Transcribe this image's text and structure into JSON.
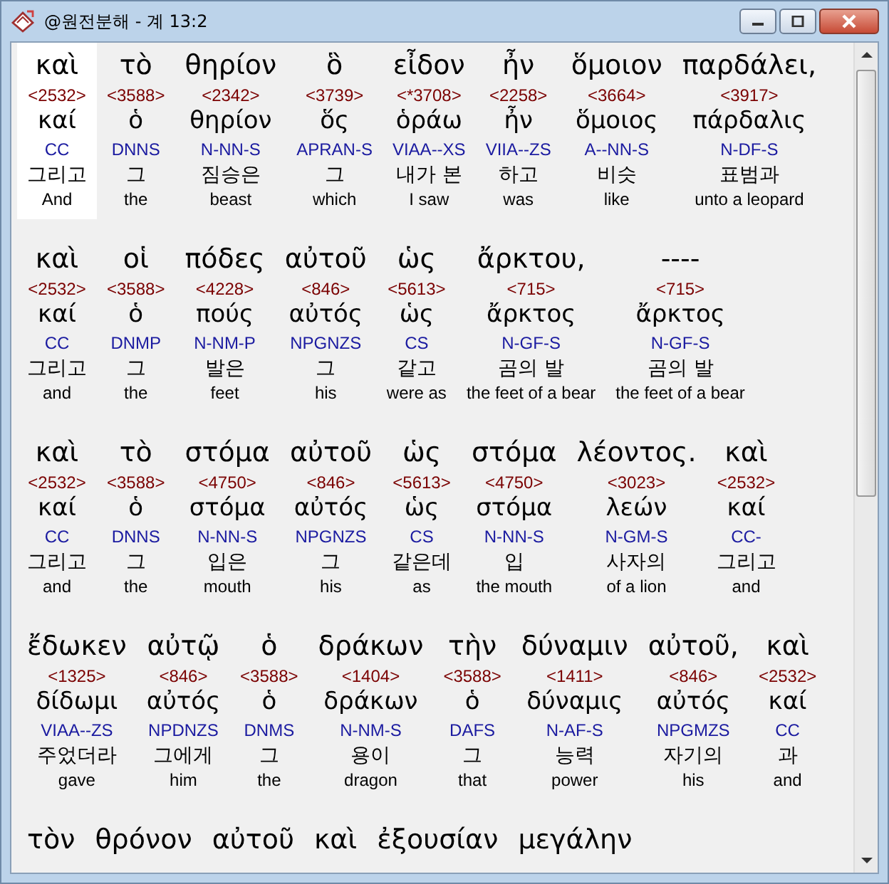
{
  "window": {
    "title": "@원전분해 - 계 13:2"
  },
  "lines": [
    {
      "words": [
        {
          "greek": "καὶ",
          "strong": "<2532>",
          "lemma": "καί",
          "morph": "CC",
          "korean": "그리고",
          "english": "And",
          "selected": true
        },
        {
          "greek": "τὸ",
          "strong": "<3588>",
          "lemma": "ὁ",
          "morph": "DNNS",
          "korean": "그",
          "english": "the",
          "selected": false
        },
        {
          "greek": "θηρίον",
          "strong": "<2342>",
          "lemma": "θηρίον",
          "morph": "N-NN-S",
          "korean": "짐승은",
          "english": "beast",
          "selected": false
        },
        {
          "greek": "ὃ",
          "strong": "<3739>",
          "lemma": "ὅς",
          "morph": "APRAN-S",
          "korean": "그",
          "english": "which",
          "selected": false
        },
        {
          "greek": "εἶδον",
          "strong": "<*3708>",
          "lemma": "ὁράω",
          "morph": "VIAA--XS",
          "korean": "내가 본",
          "english": "I saw",
          "selected": false
        },
        {
          "greek": "ἦν",
          "strong": "<2258>",
          "lemma": "ἦν",
          "morph": "VIIA--ZS",
          "korean": "하고",
          "english": "was",
          "selected": false
        },
        {
          "greek": "ὅμοιον",
          "strong": "<3664>",
          "lemma": "ὅμοιος",
          "morph": "A--NN-S",
          "korean": "비슷",
          "english": "like",
          "selected": false
        },
        {
          "greek": "παρδάλει,",
          "strong": "<3917>",
          "lemma": "πάρδαλις",
          "morph": "N-DF-S",
          "korean": "표범과",
          "english": "unto a leopard",
          "selected": false
        }
      ]
    },
    {
      "words": [
        {
          "greek": "καὶ",
          "strong": "<2532>",
          "lemma": "καί",
          "morph": "CC",
          "korean": "그리고",
          "english": "and",
          "selected": false
        },
        {
          "greek": "οἱ",
          "strong": "<3588>",
          "lemma": "ὁ",
          "morph": "DNMP",
          "korean": "그",
          "english": "the",
          "selected": false
        },
        {
          "greek": "πόδες",
          "strong": "<4228>",
          "lemma": "πούς",
          "morph": "N-NM-P",
          "korean": "발은",
          "english": "feet",
          "selected": false
        },
        {
          "greek": "αὐτοῦ",
          "strong": "<846>",
          "lemma": "αὐτός",
          "morph": "NPGNZS",
          "korean": "그",
          "english": "his",
          "selected": false
        },
        {
          "greek": "ὡς",
          "strong": "<5613>",
          "lemma": "ὡς",
          "morph": "CS",
          "korean": "같고",
          "english": "were as",
          "selected": false
        },
        {
          "greek": "ἄρκτου,",
          "strong": "<715>",
          "lemma": "ἄρκτος",
          "morph": "N-GF-S",
          "korean": "곰의 발",
          "english": "the feet of a bear",
          "selected": false
        },
        {
          "greek": "----",
          "strong": "<715>",
          "lemma": "ἄρκτος",
          "morph": "N-GF-S",
          "korean": "곰의 발",
          "english": "the feet of a bear",
          "selected": false
        }
      ]
    },
    {
      "words": [
        {
          "greek": "καὶ",
          "strong": "<2532>",
          "lemma": "καί",
          "morph": "CC",
          "korean": "그리고",
          "english": "and",
          "selected": false
        },
        {
          "greek": "τὸ",
          "strong": "<3588>",
          "lemma": "ὁ",
          "morph": "DNNS",
          "korean": "그",
          "english": "the",
          "selected": false
        },
        {
          "greek": "στόμα",
          "strong": "<4750>",
          "lemma": "στόμα",
          "morph": "N-NN-S",
          "korean": "입은",
          "english": "mouth",
          "selected": false
        },
        {
          "greek": "αὐτοῦ",
          "strong": "<846>",
          "lemma": "αὐτός",
          "morph": "NPGNZS",
          "korean": "그",
          "english": "his",
          "selected": false
        },
        {
          "greek": "ὡς",
          "strong": "<5613>",
          "lemma": "ὡς",
          "morph": "CS",
          "korean": "같은데",
          "english": "as",
          "selected": false
        },
        {
          "greek": "στόμα",
          "strong": "<4750>",
          "lemma": "στόμα",
          "morph": "N-NN-S",
          "korean": "입",
          "english": "the mouth",
          "selected": false
        },
        {
          "greek": "λέοντος.",
          "strong": "<3023>",
          "lemma": "λεών",
          "morph": "N-GM-S",
          "korean": "사자의",
          "english": "of a lion",
          "selected": false
        },
        {
          "greek": "καὶ",
          "strong": "<2532>",
          "lemma": "καί",
          "morph": "CC-",
          "korean": "그리고",
          "english": "and",
          "selected": false
        }
      ]
    },
    {
      "words": [
        {
          "greek": "ἔδωκεν",
          "strong": "<1325>",
          "lemma": "δίδωμι",
          "morph": "VIAA--ZS",
          "korean": "주었더라",
          "english": "gave",
          "selected": false
        },
        {
          "greek": "αὐτῷ",
          "strong": "<846>",
          "lemma": "αὐτός",
          "morph": "NPDNZS",
          "korean": "그에게",
          "english": "him",
          "selected": false
        },
        {
          "greek": "ὁ",
          "strong": "<3588>",
          "lemma": "ὁ",
          "morph": "DNMS",
          "korean": "그",
          "english": "the",
          "selected": false
        },
        {
          "greek": "δράκων",
          "strong": "<1404>",
          "lemma": "δράκων",
          "morph": "N-NM-S",
          "korean": "용이",
          "english": "dragon",
          "selected": false
        },
        {
          "greek": "τὴν",
          "strong": "<3588>",
          "lemma": "ὁ",
          "morph": "DAFS",
          "korean": "그",
          "english": "that",
          "selected": false
        },
        {
          "greek": "δύναμιν",
          "strong": "<1411>",
          "lemma": "δύναμις",
          "morph": "N-AF-S",
          "korean": "능력",
          "english": "power",
          "selected": false
        },
        {
          "greek": "αὐτοῦ,",
          "strong": "<846>",
          "lemma": "αὐτός",
          "morph": "NPGMZS",
          "korean": "자기의",
          "english": "his",
          "selected": false
        },
        {
          "greek": "καὶ",
          "strong": "<2532>",
          "lemma": "καί",
          "morph": "CC",
          "korean": "과",
          "english": "and",
          "selected": false
        }
      ]
    },
    {
      "words": [
        {
          "greek": "τὸν",
          "selected": false
        },
        {
          "greek": "θρόνον",
          "selected": false
        },
        {
          "greek": "αὐτοῦ",
          "selected": false
        },
        {
          "greek": "καὶ",
          "selected": false
        },
        {
          "greek": "ἐξουσίαν",
          "selected": false
        },
        {
          "greek": "μεγάλην",
          "selected": false
        }
      ]
    }
  ]
}
